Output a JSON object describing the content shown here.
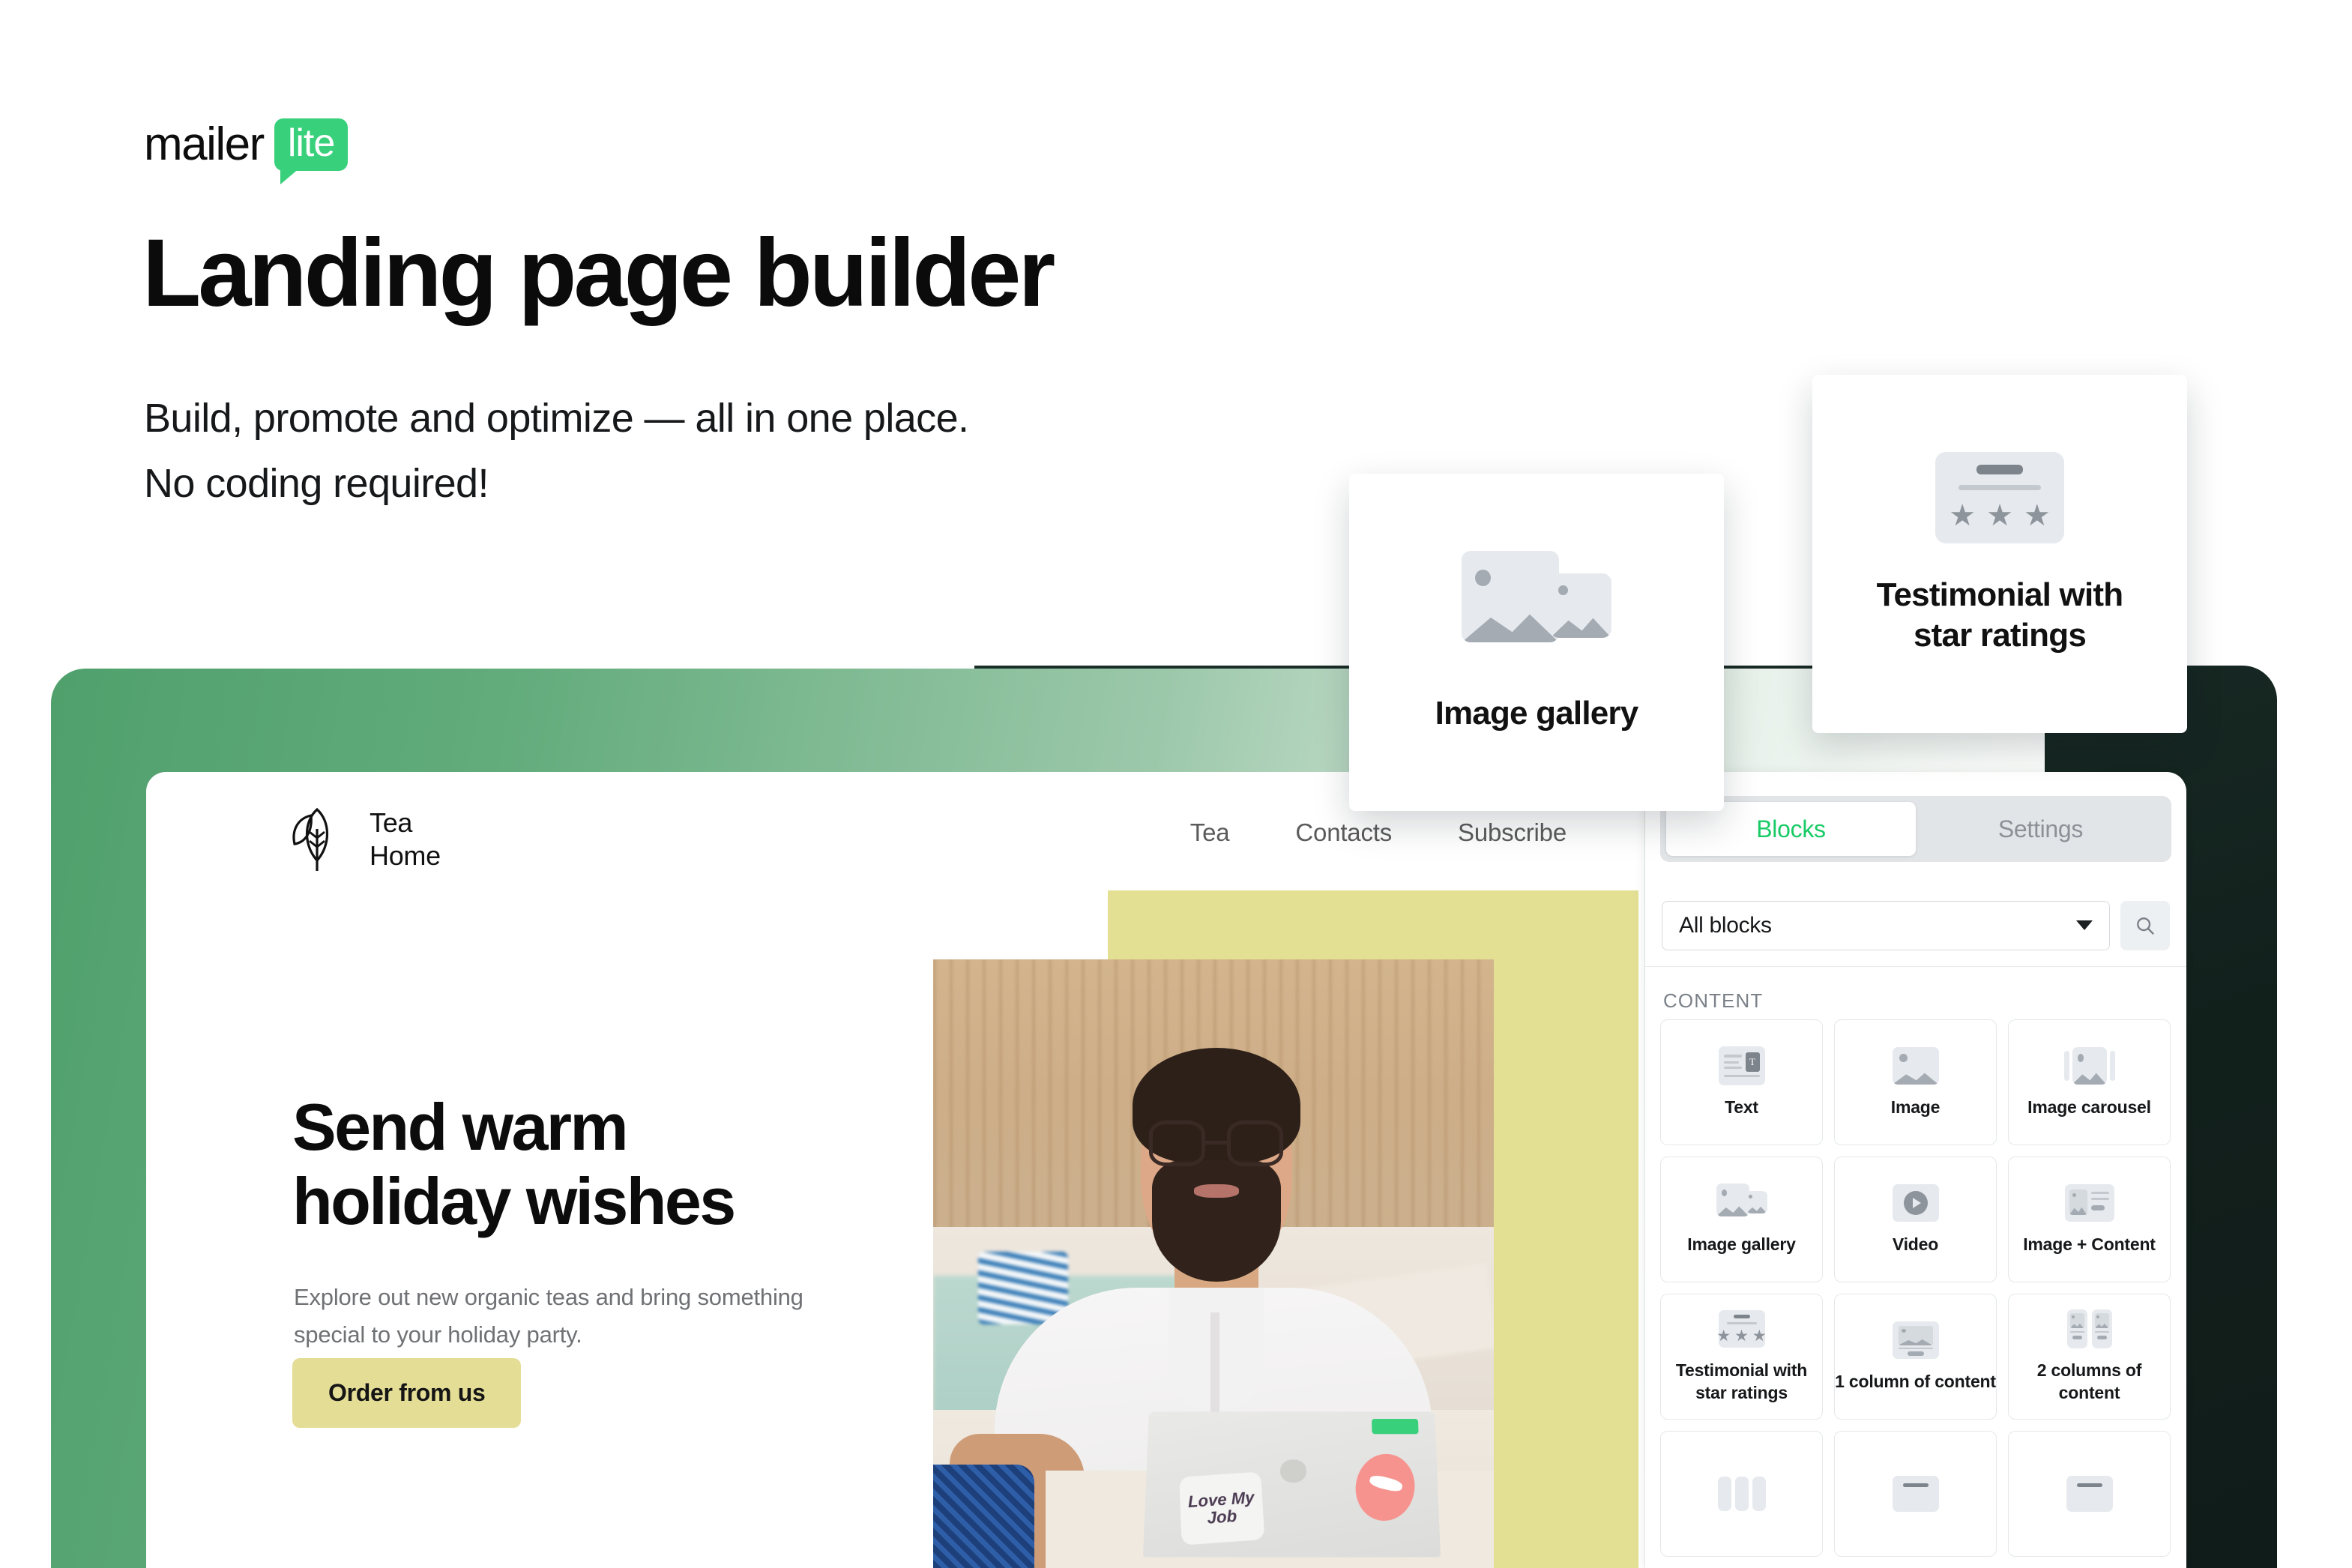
{
  "brand": {
    "word": "mailer",
    "badge": "lite",
    "accent": "#38d07b"
  },
  "hero": {
    "headline": "Landing page builder",
    "subline_line1": "Build, promote and optimize — all in one place.",
    "subline_line2": "No coding required!"
  },
  "floating_cards": [
    {
      "label": "Image gallery",
      "icon": "image-gallery-icon"
    },
    {
      "label": "Testimonial with\nstar ratings",
      "label_line1": "Testimonial with",
      "label_line2": "star ratings",
      "icon": "testimonial-star-icon"
    }
  ],
  "preview": {
    "logo": {
      "name_line1": "Tea",
      "name_line2": "Home",
      "icon": "leaf-icon"
    },
    "nav": [
      "Tea",
      "Contacts",
      "Subscribe"
    ],
    "hero_title_line1": "Send warm",
    "hero_title_line2": "holiday wishes",
    "hero_body": "Explore out new organic teas and bring something special to your holiday party.",
    "cta_label": "Order from us",
    "cta_color": "#e4dd96",
    "accent_block_color": "#e3e093",
    "photo_alt": "Man with glasses and beard in white shirt working on a laptop by a pool",
    "laptop_sticker": "Love My Job"
  },
  "editor": {
    "tabs": [
      {
        "label": "Blocks",
        "active": true
      },
      {
        "label": "Settings",
        "active": false
      }
    ],
    "filter": {
      "value": "All blocks",
      "icon": "chevron-down-icon"
    },
    "search_icon": "search-icon",
    "section_title": "CONTENT",
    "blocks": [
      {
        "label": "Text",
        "icon": "text-icon"
      },
      {
        "label": "Image",
        "icon": "image-icon"
      },
      {
        "label": "Image carousel",
        "icon": "image-carousel-icon"
      },
      {
        "label": "Image gallery",
        "icon": "image-gallery-icon"
      },
      {
        "label": "Video",
        "icon": "video-icon"
      },
      {
        "label": "Image + Content",
        "icon": "image-content-icon"
      },
      {
        "label": "Testimonial with star ratings",
        "icon": "testimonial-star-icon"
      },
      {
        "label": "1 column of content",
        "icon": "one-column-icon"
      },
      {
        "label": "2 columns of content",
        "icon": "two-columns-icon"
      }
    ],
    "active_tab_color": "#19cb66"
  },
  "theme": {
    "green_band_start": "#4fa06c",
    "dark_panel": "#12201c"
  }
}
